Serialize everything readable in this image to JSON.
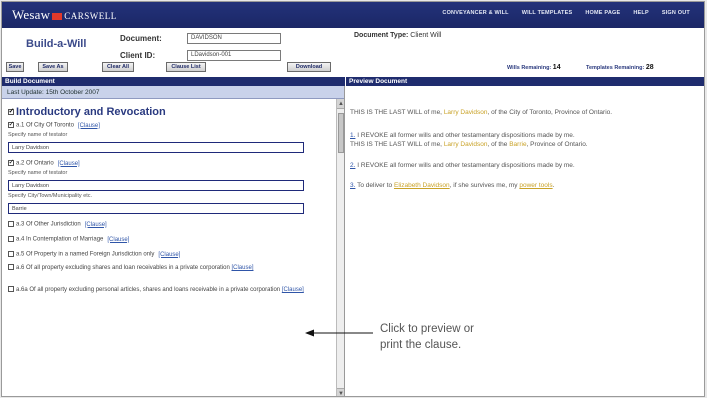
{
  "brand": {
    "logo_left": "Wes",
    "logo_mid": "aw",
    "logo_right": "CARSWELL"
  },
  "top_links": [
    "CONVEYANCER & WILL",
    "WILL TEMPLATES",
    "HOME PAGE",
    "HELP",
    "SIGN OUT"
  ],
  "app_title": "Build-a-Will",
  "document_label": "Document:",
  "document_value": "DAVIDSON",
  "client_id_label": "Client ID:",
  "client_id_value": "LDavidson-001",
  "document_type_label": "Document Type:",
  "document_type_value": "Client Will",
  "buttons": [
    "Save",
    "Save As",
    "Clear All",
    "Clause List",
    "Download"
  ],
  "wills_remaining_label": "Wills Remaining:",
  "wills_remaining_value": "14",
  "templates_remaining_label": "Templates Remaining:",
  "templates_remaining_value": "28",
  "build_header": "Build Document",
  "preview_header": "Preview Document",
  "last_update": "Last Update: 15th October 2007",
  "section_title": "Introductory and Revocation",
  "options": [
    {
      "text": "a.1 Of City Of Toronto",
      "clause": "[Clause]",
      "checked": true
    },
    {
      "text": "a.2 Of Ontario",
      "clause": "[Clause]",
      "checked": true
    },
    {
      "text": "a.3 Of Other Jurisdiction",
      "clause": "[Clause]",
      "checked": false
    },
    {
      "text": "a.4 In Contemplation of Marriage",
      "clause": "[Clause]",
      "checked": false
    },
    {
      "text": "a.5 Of Property in a named Foreign Jurisdiction only",
      "clause": "[Clause]",
      "checked": false
    },
    {
      "text": "a.6 Of all property excluding shares and loan receivables in a private corporation",
      "clause": "[Clause]",
      "checked": false
    },
    {
      "text": "a.6a Of all property excluding personal articles, shares and loans receivable in a private corporation",
      "clause": "[Clause]",
      "checked": false
    }
  ],
  "field_caption_name": "Specify name of testator",
  "field_value_1": "Larry Davidson",
  "field_value_2": "Larry Davidson",
  "field_caption_city": "Specify City/Town/Municipality etc.",
  "field_value_city": "Barrie",
  "preview": {
    "p1_a": "THIS IS THE LAST WILL of me,",
    "p1_name": "Larry Davidson",
    "p1_b": ", of the City of Toronto, Province of Ontario.",
    "p2_num": "1.",
    "p2_text": "I REVOKE all former wills and other testamentary dispositions made by me.",
    "p3_a": "THIS IS THE LAST WILL of me,",
    "p3_name": "Larry Davidson",
    "p3_b": ", of the",
    "p3_city": "Barrie",
    "p3_c": ", Province of Ontario.",
    "p4_num": "2.",
    "p4_text": "I REVOKE all former wills and other testamentary dispositions made by me.",
    "p5_num": "3.",
    "p5_a": "To deliver to",
    "p5_name": "Elizabeth Davidson",
    "p5_b": ", if she survives me, my",
    "p5_item": "power tools",
    "p5_c": "."
  },
  "callout_line1": "Click to preview or",
  "callout_line2": "print the clause."
}
